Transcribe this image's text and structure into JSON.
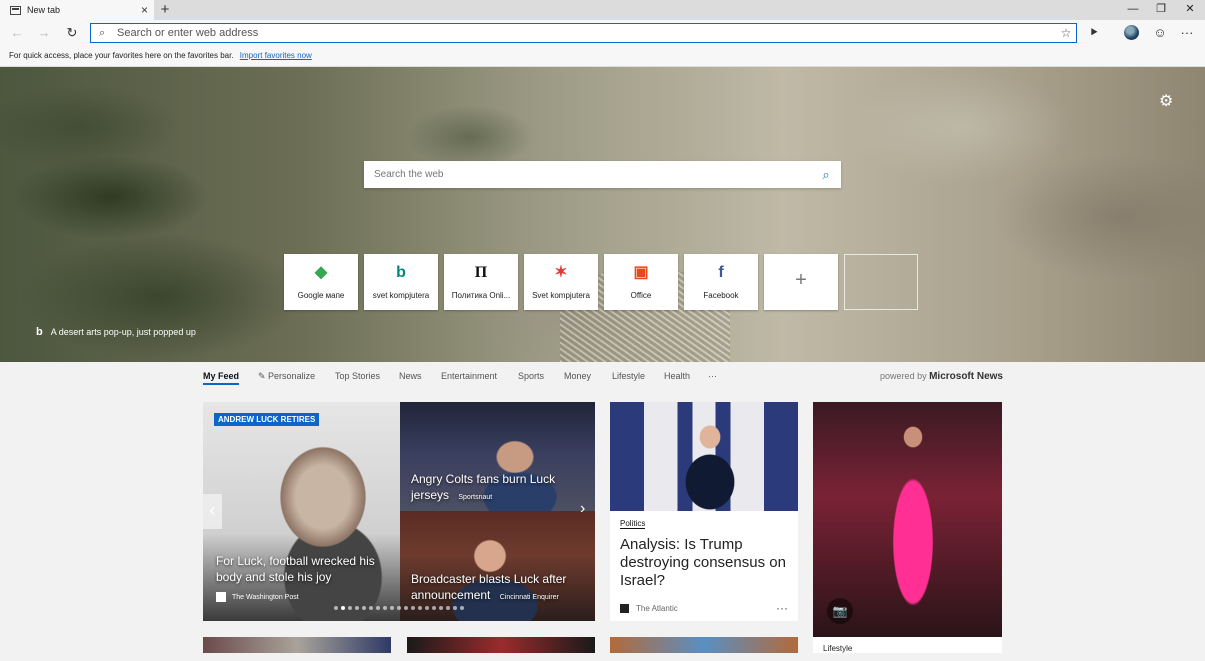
{
  "tab": {
    "title": "New tab"
  },
  "window_controls": {
    "minimize": "—",
    "restore": "❐",
    "close": "✕"
  },
  "address": {
    "placeholder": "Search or enter web address"
  },
  "favorites_hint": {
    "text": "For quick access, place your favorites here on the favorites bar.",
    "link": "Import favorites now"
  },
  "web_search": {
    "placeholder": "Search the web"
  },
  "tiles": [
    {
      "label": "Google мапе",
      "icon": "google-maps-icon",
      "color": "#34a853"
    },
    {
      "label": "svet kompjutera",
      "icon": "bing-icon",
      "color": "#00897b"
    },
    {
      "label": "Политика Onli...",
      "icon": "politika-icon",
      "color": "#111111"
    },
    {
      "label": "Svet kompjutera",
      "icon": "svet-kompjutera-icon",
      "color": "#e53935"
    },
    {
      "label": "Office",
      "icon": "office-icon",
      "color": "#e64a19"
    },
    {
      "label": "Facebook",
      "icon": "facebook-icon",
      "color": "#3b5998"
    }
  ],
  "hero_caption": "A desert arts pop-up, just popped up",
  "feed_nav": {
    "items": [
      "My Feed",
      "Personalize",
      "Top Stories",
      "News",
      "Entertainment",
      "Sports",
      "Money",
      "Lifestyle",
      "Health",
      "···"
    ],
    "powered_prefix": "powered by",
    "powered_brand": "Microsoft News"
  },
  "cards": {
    "main": {
      "badge": "ANDREW LUCK RETIRES",
      "title": "For Luck, football wrecked his body and stole his joy",
      "source": "The Washington Post"
    },
    "top_right": {
      "title": "Angry Colts fans burn Luck jerseys",
      "source": "Sportsnaut"
    },
    "bottom_right": {
      "title": "Broadcaster blasts Luck after announcement",
      "source": "Cincinnati Enquirer"
    },
    "politics": {
      "category": "Politics",
      "title": "Analysis: Is Trump destroying consensus on Israel?",
      "source": "The Atlantic"
    },
    "lifestyle": {
      "category": "Lifestyle"
    }
  },
  "carousel": {
    "count": 19,
    "active": 1
  },
  "colors": {
    "accent": "#0a66c8",
    "badge": "#0a66c8"
  }
}
